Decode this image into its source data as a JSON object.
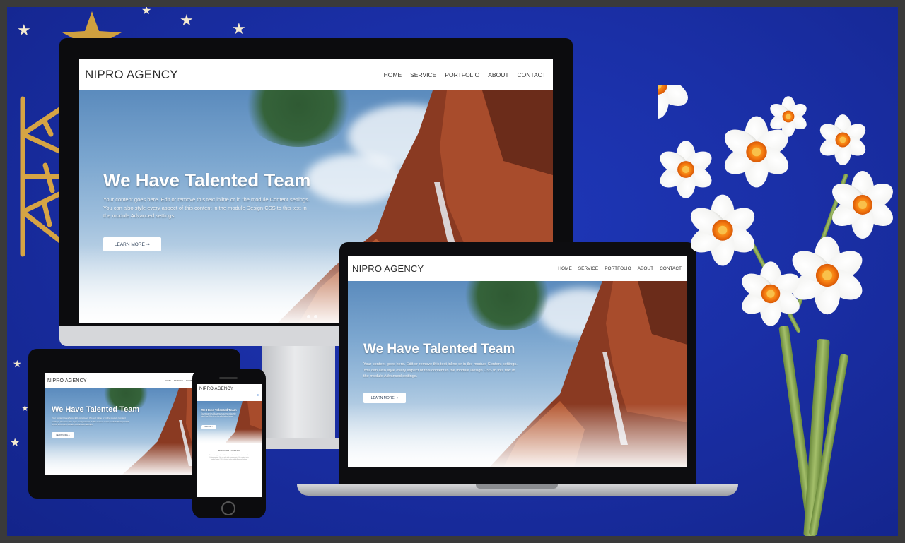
{
  "brand": {
    "logo": "NIPRO AGENCY"
  },
  "nav": {
    "items": [
      {
        "label": "HOME"
      },
      {
        "label": "SERVICE"
      },
      {
        "label": "PORTFOLIO"
      },
      {
        "label": "ABOUT"
      },
      {
        "label": "CONTACT"
      }
    ]
  },
  "hero": {
    "title": "We Have Talented Team",
    "body": "Your content goes here. Edit or remove this text inline or in the module Content settings. You can also style every aspect of this content in the module Design CSS to this text in the module Advanced settings.",
    "button": "LEARN MORE ➞"
  },
  "phone_section": {
    "heading": "WELCOME TO NIPRO"
  },
  "colors": {
    "background_blue": "#1a2fa6",
    "header_bg": "#ffffff",
    "device_bezel": "#0c0c0e",
    "flower_center": "#f47a10"
  },
  "icons": [
    "star-icon",
    "snowflake-ornament-icon",
    "flower-icon"
  ]
}
